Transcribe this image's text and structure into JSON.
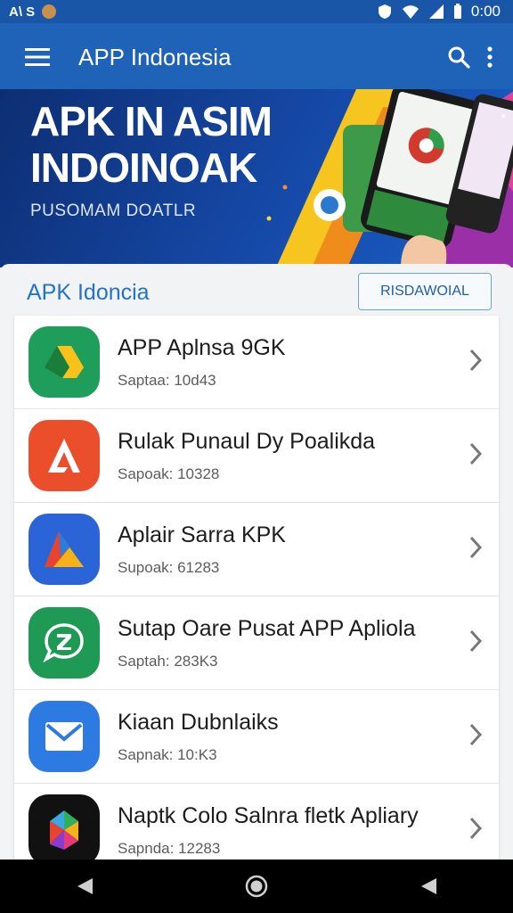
{
  "status": {
    "left_text": "A\\ S",
    "time": "0:00"
  },
  "appbar": {
    "title": "APP Indonesia"
  },
  "hero": {
    "line1": "APK IN ASIM",
    "line2": "INDOINOAK",
    "subtitle": "PUSOMAM DOATLR"
  },
  "section": {
    "title": "APK Idoncia",
    "button": "RISDAWOIAL"
  },
  "apps": [
    {
      "name": "APP Aplnsa 9GK",
      "size": "Saptaa: 10d43",
      "color": "#1e9e5a"
    },
    {
      "name": "Rulak Punaul Dy Poalikda",
      "size": "Sapoak: 10328",
      "color": "#ea4e2a"
    },
    {
      "name": "Aplair Sarra KPK",
      "size": "Supoak: 61283",
      "color": "#2b64d6"
    },
    {
      "name": "Sutap Oare Pusat APP Apliola",
      "size": "Saptah: 283K3",
      "color": "#1e9a55"
    },
    {
      "name": "Kiaan Dubnlaiks",
      "size": "Sapnak: 10:K3",
      "color": "#2d7be2"
    },
    {
      "name": "Naptk Colo Salnra fletk Apliary",
      "size": "Sapnda: 12283",
      "color": "#111111"
    }
  ]
}
